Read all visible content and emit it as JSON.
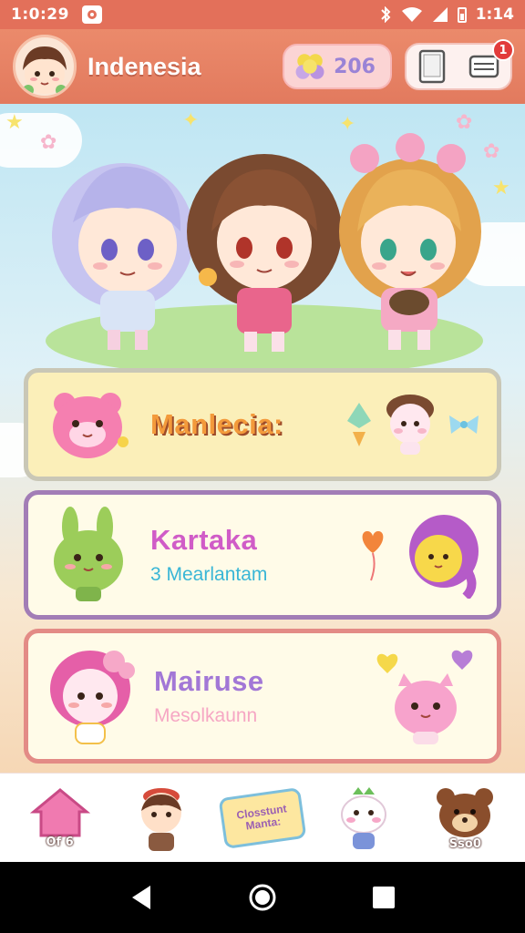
{
  "status_bar": {
    "time": "1:0:29",
    "battery_text": "1:14"
  },
  "header": {
    "title": "Indenesia",
    "coins": "206",
    "notification_count": "1"
  },
  "cards": [
    {
      "title": "Manlecia:",
      "subtitle": ""
    },
    {
      "title": "Kartaka",
      "subtitle": "3 Mearlantam"
    },
    {
      "title": "Mairuse",
      "subtitle": "Mesolkaunn"
    }
  ],
  "bottom_nav": {
    "home_label": "Of 6",
    "sign_line1": "Closstunt",
    "sign_line2": "Manta:",
    "bear_label": "Sso0"
  },
  "colors": {
    "header": "#e27a5e",
    "accent_orange": "#f39a3b",
    "accent_purple": "#a277d6",
    "accent_pink": "#d05cc7",
    "badge": "#e23b3b"
  },
  "icons": [
    "wifi-icon",
    "signal-icon",
    "tablet-icon",
    "mail-icon",
    "home-icon",
    "back-icon",
    "circle-home-icon",
    "square-recents-icon"
  ]
}
